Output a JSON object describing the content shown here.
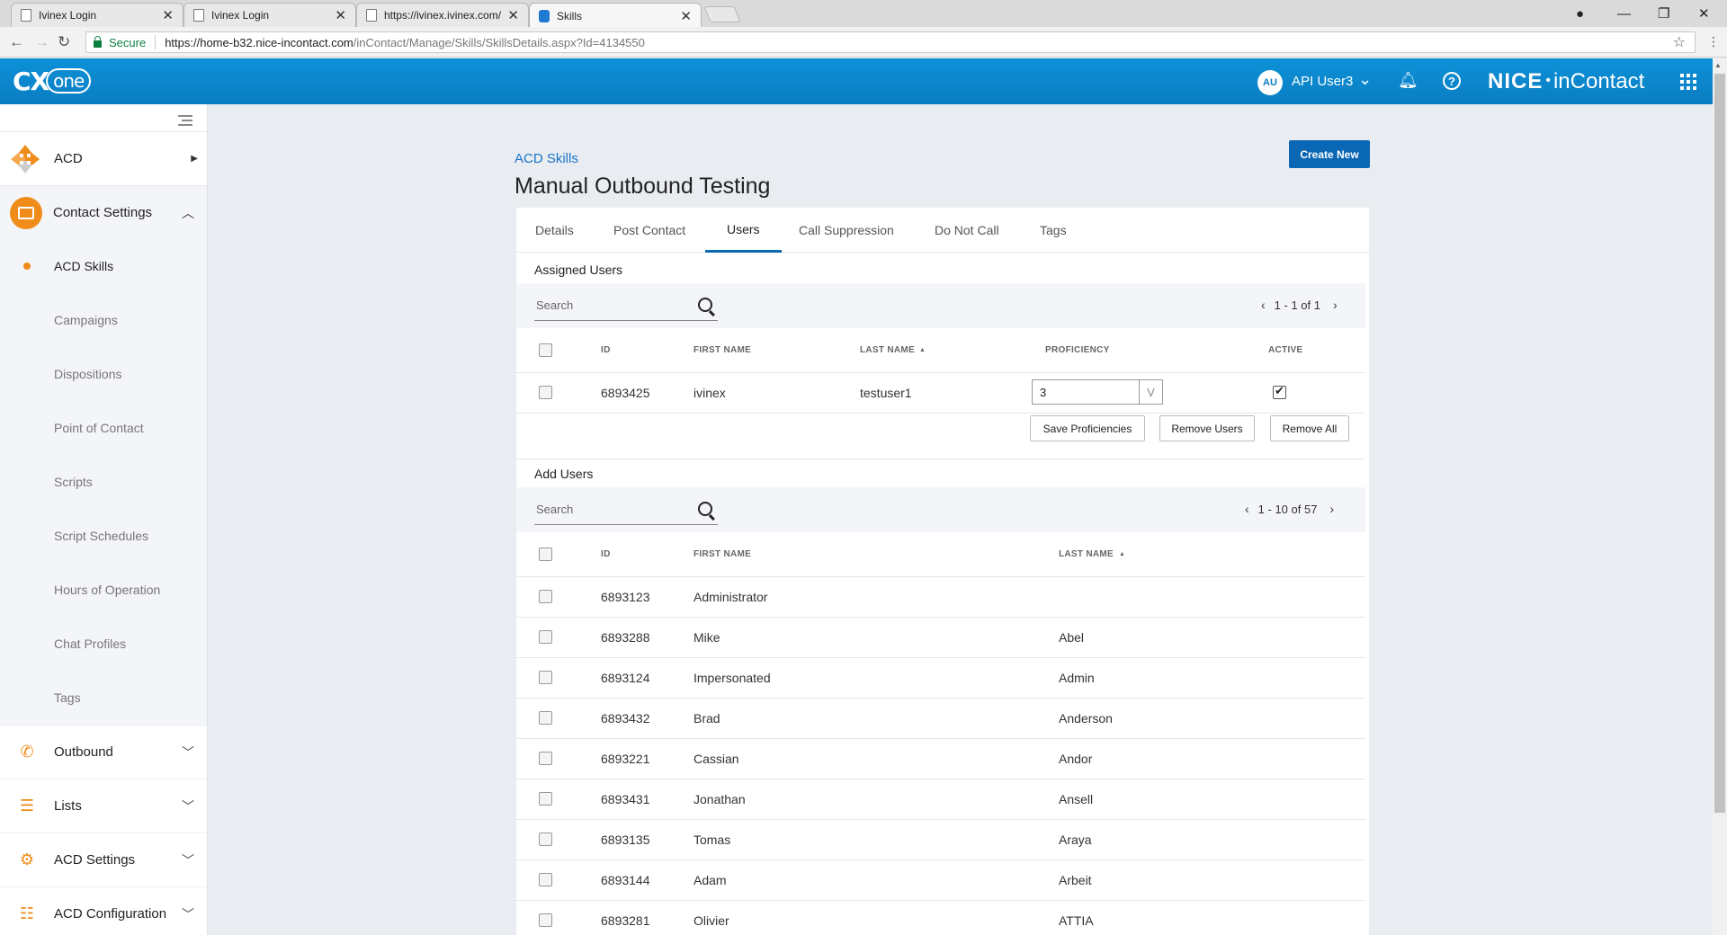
{
  "browser": {
    "tabs": [
      {
        "title": "Ivinex Login"
      },
      {
        "title": "Ivinex Login"
      },
      {
        "title": "https://ivinex.ivinex.com/"
      },
      {
        "title": "Skills"
      }
    ],
    "secure_label": "Secure",
    "url_host": "https://home-b32.nice-incontact.com",
    "url_path": "/inContact/Manage/Skills/SkillsDetails.aspx?Id=4134550"
  },
  "header": {
    "logo_cx": "CX",
    "logo_one": "one",
    "avatar_initials": "AU",
    "username": "API User3",
    "brand_nice": "NICE",
    "brand_incontact": "inContact"
  },
  "sidebar": {
    "acd_label": "ACD",
    "contact_settings_label": "Contact Settings",
    "sub_items": [
      "ACD Skills",
      "Campaigns",
      "Dispositions",
      "Point of Contact",
      "Scripts",
      "Script Schedules",
      "Hours of Operation",
      "Chat Profiles",
      "Tags"
    ],
    "items": [
      {
        "label": "Outbound"
      },
      {
        "label": "Lists"
      },
      {
        "label": "ACD Settings"
      },
      {
        "label": "ACD Configuration"
      }
    ]
  },
  "page": {
    "breadcrumb": "ACD Skills",
    "title": "Manual Outbound Testing",
    "create_label": "Create New",
    "tabs": [
      "Details",
      "Post Contact",
      "Users",
      "Call Suppression",
      "Do Not Call",
      "Tags"
    ],
    "active_tab": "Users"
  },
  "assigned": {
    "heading": "Assigned Users",
    "search_placeholder": "Search",
    "pager": "1 - 1 of 1",
    "columns": {
      "id": "ID",
      "first": "FIRST NAME",
      "last": "LAST NAME",
      "last_sort": "▲",
      "proficiency": "PROFICIENCY",
      "active": "ACTIVE"
    },
    "rows": [
      {
        "id": "6893425",
        "first": "ivinex",
        "last": "testuser1",
        "proficiency": "3",
        "dd": "V",
        "active": true
      }
    ],
    "save_label": "Save Proficiencies",
    "remove_label": "Remove Users",
    "remove_all_label": "Remove All"
  },
  "add": {
    "heading": "Add Users",
    "search_placeholder": "Search",
    "pager": "1 - 10 of 57",
    "columns": {
      "id": "ID",
      "first": "FIRST NAME",
      "last": "LAST NAME",
      "last_sort": "▲"
    },
    "rows": [
      {
        "id": "6893123",
        "first": "Administrator",
        "last": ""
      },
      {
        "id": "6893288",
        "first": "Mike",
        "last": "Abel"
      },
      {
        "id": "6893124",
        "first": "Impersonated",
        "last": "Admin"
      },
      {
        "id": "6893432",
        "first": "Brad",
        "last": "Anderson"
      },
      {
        "id": "6893221",
        "first": "Cassian",
        "last": "Andor"
      },
      {
        "id": "6893431",
        "first": "Jonathan",
        "last": "Ansell"
      },
      {
        "id": "6893135",
        "first": "Tomas",
        "last": "Araya"
      },
      {
        "id": "6893144",
        "first": "Adam",
        "last": "Arbeit"
      },
      {
        "id": "6893281",
        "first": "Olivier",
        "last": "ATTIA"
      }
    ]
  },
  "colors": {
    "accent": "#0a67b3",
    "header": "#0a7dc2",
    "orange": "#f08c1a"
  }
}
